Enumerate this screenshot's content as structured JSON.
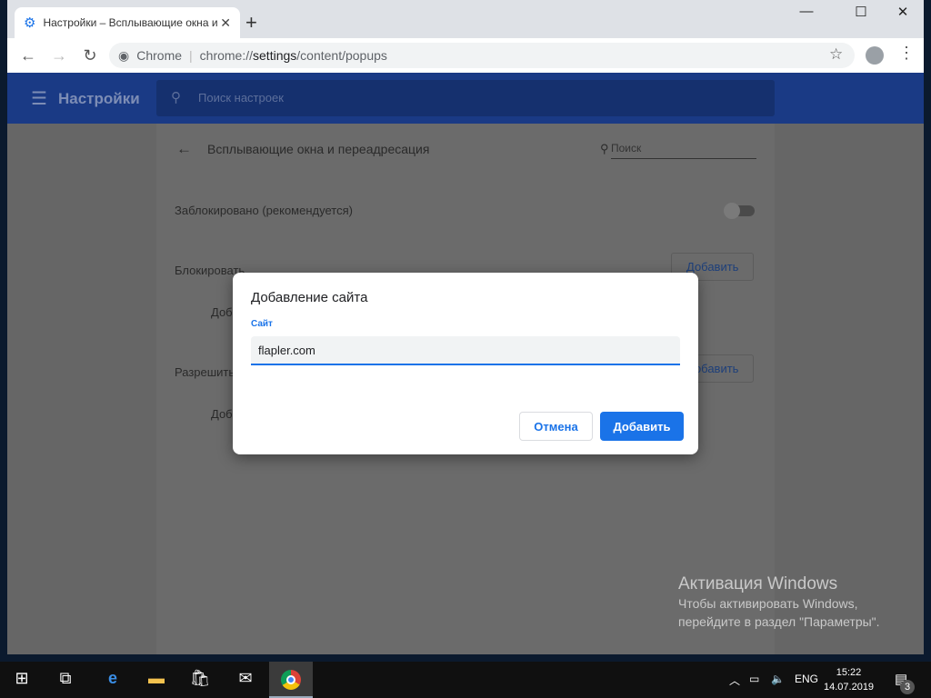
{
  "browser": {
    "tab_title": "Настройки – Всплывающие окна и переадресация",
    "omnibox_origin": "Chrome",
    "url_prefix": "chrome://",
    "url_host": "settings",
    "url_path": "/content/popups"
  },
  "settings_header": {
    "title": "Настройки",
    "search_placeholder": "Поиск настроек"
  },
  "page": {
    "title": "Всплывающие окна и переадресация",
    "search_placeholder": "Поиск",
    "blocked_label": "Заблокировано (рекомендуется)",
    "blocked_toggle_on": false,
    "block_section": "Блокировать",
    "allow_section": "Разрешить",
    "add_label": "Добавить",
    "empty_block": "Доб",
    "empty_allow": "Доб"
  },
  "dialog": {
    "title": "Добавление сайта",
    "field_label": "Сайт",
    "field_value": "flapler.com",
    "cancel": "Отмена",
    "add": "Добавить"
  },
  "watermark": {
    "title": "Активация Windows",
    "line1": "Чтобы активировать Windows,",
    "line2": "перейдите в раздел \"Параметры\"."
  },
  "taskbar": {
    "lang": "ENG",
    "time": "15:22",
    "date": "14.07.2019",
    "notifications": "3"
  }
}
